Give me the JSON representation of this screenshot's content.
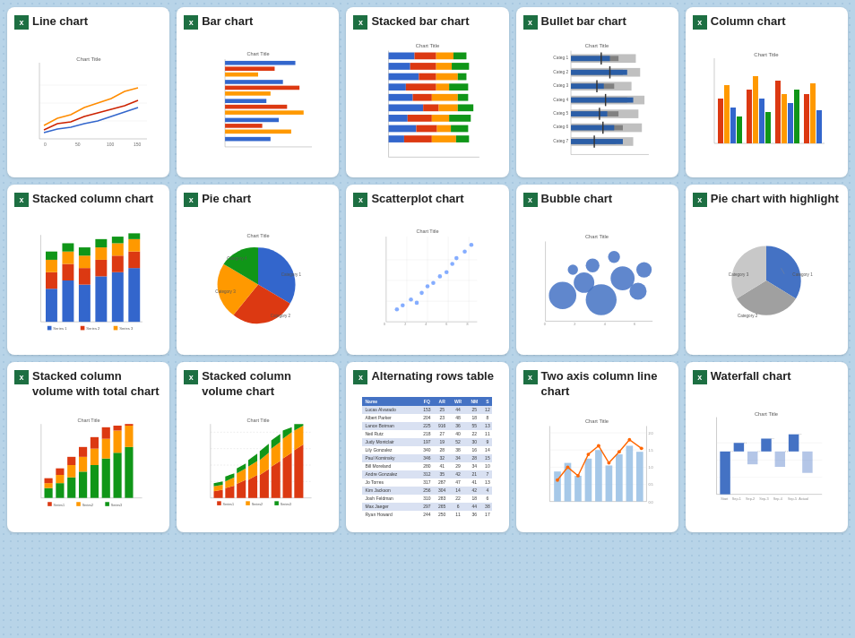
{
  "charts": [
    {
      "id": "line-chart",
      "title": "Line chart",
      "type": "line"
    },
    {
      "id": "bar-chart",
      "title": "Bar chart",
      "type": "bar"
    },
    {
      "id": "stacked-bar-chart",
      "title": "Stacked bar chart",
      "type": "stacked-bar"
    },
    {
      "id": "bullet-bar-chart",
      "title": "Bullet bar chart",
      "type": "bullet-bar"
    },
    {
      "id": "column-chart",
      "title": "Column chart",
      "type": "column"
    },
    {
      "id": "stacked-column-chart",
      "title": "Stacked column chart",
      "type": "stacked-column"
    },
    {
      "id": "pie-chart",
      "title": "Pie chart",
      "type": "pie"
    },
    {
      "id": "scatterplot-chart",
      "title": "Scatterplot chart",
      "type": "scatter"
    },
    {
      "id": "bubble-chart",
      "title": "Bubble chart",
      "type": "bubble"
    },
    {
      "id": "pie-highlight-chart",
      "title": "Pie chart with highlight",
      "type": "pie-highlight"
    },
    {
      "id": "stacked-col-volume-total-chart",
      "title": "Stacked column volume with total chart",
      "type": "scv-total"
    },
    {
      "id": "stacked-col-volume-chart",
      "title": "Stacked column volume chart",
      "type": "scv"
    },
    {
      "id": "alternating-rows-table",
      "title": "Alternating rows table",
      "type": "alt-table"
    },
    {
      "id": "two-axis-chart",
      "title": "Two axis column line chart",
      "type": "two-axis"
    },
    {
      "id": "waterfall-chart",
      "title": "Waterfall chart",
      "type": "waterfall"
    }
  ]
}
